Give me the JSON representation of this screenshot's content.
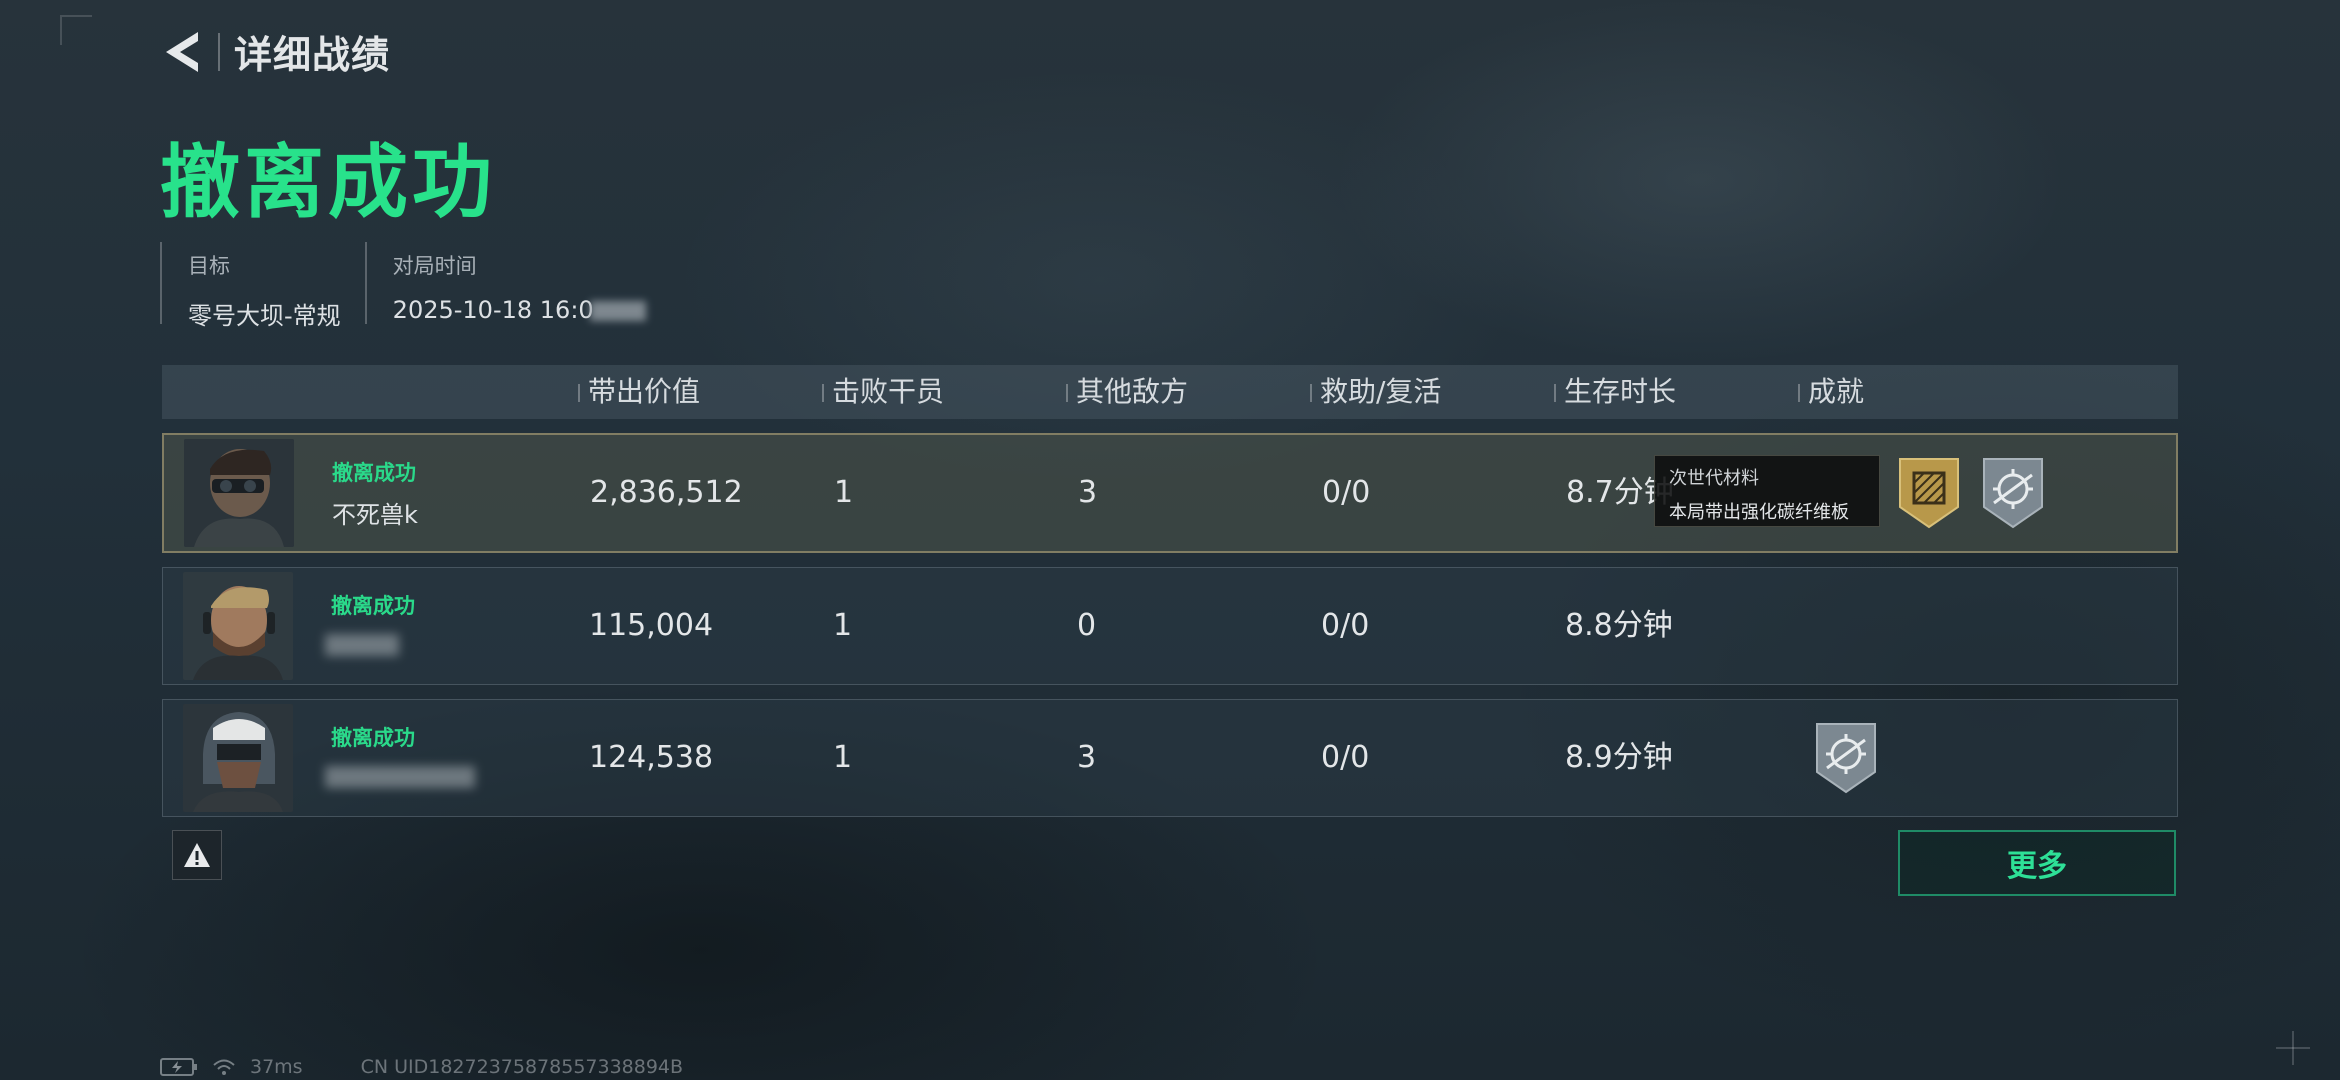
{
  "header": {
    "title": "详细战绩"
  },
  "result": {
    "status": "撤离成功"
  },
  "info": {
    "target_label": "目标",
    "target_value": "零号大坝-常规",
    "time_label": "对局时间",
    "time_value": "2025-10-18 16:0"
  },
  "table": {
    "headers": [
      "带出价值",
      "击败干员",
      "其他敌方",
      "救助/复活",
      "生存时长",
      "成就"
    ],
    "rows": [
      {
        "status": "撤离成功",
        "name": "不死兽k",
        "value": "2,836,512",
        "kills": "1",
        "other": "3",
        "assist": "0/0",
        "time": "8.7分钟",
        "badges": [
          "gold-crate-badge",
          "silver-scope-badge"
        ]
      },
      {
        "status": "撤离成功",
        "name": "",
        "value": "115,004",
        "kills": "1",
        "other": "0",
        "assist": "0/0",
        "time": "8.8分钟",
        "badges": []
      },
      {
        "status": "撤离成功",
        "name": "",
        "value": "124,538",
        "kills": "1",
        "other": "3",
        "assist": "0/0",
        "time": "8.9分钟",
        "badges": [
          "silver-scope-badge"
        ]
      }
    ]
  },
  "tooltip": {
    "title": "次世代材料",
    "desc": "本局带出强化碳纤维板"
  },
  "buttons": {
    "more": "更多"
  },
  "footer": {
    "ping": "37ms",
    "uid": "CN UID18272375878557338894B"
  },
  "colors": {
    "accent_green": "#28e28b",
    "gold_badge": "#b8984a",
    "silver_badge": "#7c8891"
  }
}
